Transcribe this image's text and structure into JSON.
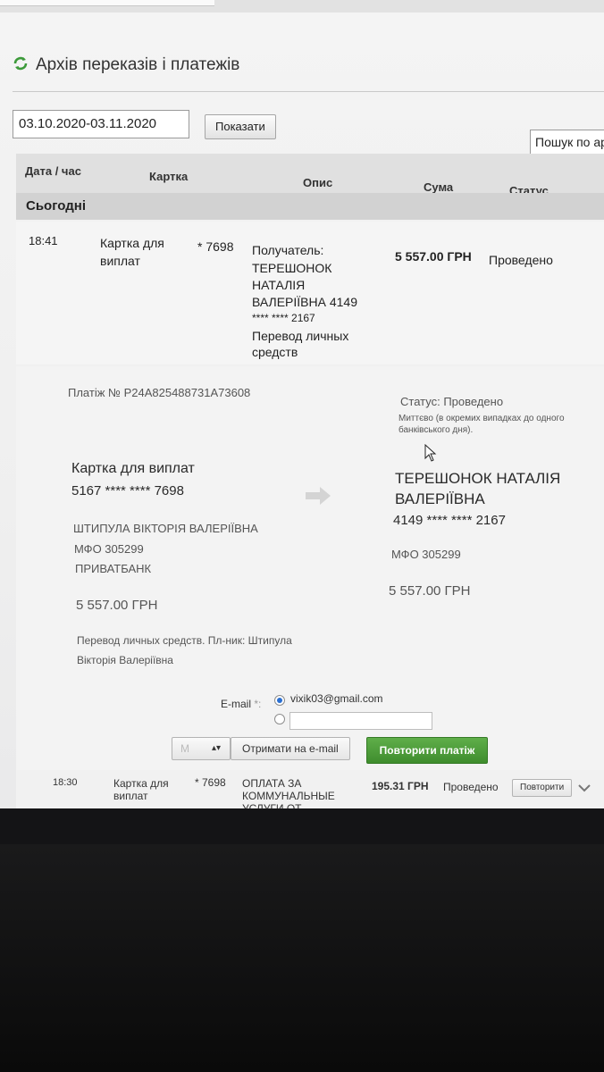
{
  "page": {
    "title": "Архів переказів і платежів"
  },
  "filters": {
    "date_range": "03.10.2020-03.11.2020",
    "show_button": "Показати",
    "search_placeholder": "Пошук по ар"
  },
  "table": {
    "headers": {
      "datetime": "Дата / час",
      "card": "Картка",
      "description": "Опис",
      "amount": "Сума",
      "status": "Статус"
    },
    "group_label": "Сьогодні"
  },
  "transaction1": {
    "time": "18:41",
    "card_line1": "Картка для",
    "card_line2": "виплат",
    "card_last4": "* 7698",
    "desc_line1": "Получатель:",
    "desc_line2": "ТЕРЕШОНОК",
    "desc_line3": "НАТАЛІЯ",
    "desc_line4": "ВАЛЕРІЇВНА 4149",
    "desc_line5": "**** **** 2167",
    "desc_line6": "Перевод личных",
    "desc_line7": "средств",
    "amount": "5 557.00 ГРН",
    "status": "Проведено"
  },
  "detail": {
    "payment_no": "Платіж № P24A825488731A73608",
    "status_line": "Статус: Проведено",
    "status_note_line1": "Миттєво (в окремих випадках до одного",
    "status_note_line2": "банківського дня).",
    "sender": {
      "card_name": "Картка для виплат",
      "card_number": "5167 **** **** 7698",
      "holder": "ШТИПУЛА ВІКТОРІЯ ВАЛЕРІЇВНА",
      "mfo": "МФО 305299",
      "bank": "ПРИВАТБАНК",
      "amount": "5 557.00 ГРН"
    },
    "receiver": {
      "name_line1": "ТЕРЕШОНОК НАТАЛІЯ",
      "name_line2": "ВАЛЕРІЇВНА",
      "card_number": "4149 **** **** 2167",
      "mfo": "МФО 305299",
      "amount": "5 557.00 ГРН"
    },
    "purpose_line1": "Перевод личных средств. Пл-ник: Штипула",
    "purpose_line2": "Вікторія Валеріївна",
    "email_label": "E-mail",
    "email_required_mark": "*:",
    "email_value": "vixik03@gmail.com",
    "format_value": "M",
    "get_email_button": "Отримати на e-mail",
    "repeat_button": "Повторити платіж"
  },
  "transaction2": {
    "time": "18:30",
    "card_line1": "Картка для",
    "card_line2": "виплат",
    "card_last4": "* 7698",
    "desc_line1": "ОПЛАТА ЗА",
    "desc_line2": "КОММУНАЛЬНЫЕ",
    "desc_line3": "УСЛУГИ ОТ",
    "amount": "195.31 ГРН",
    "status": "Проведено",
    "repeat_button": "Повторити"
  },
  "colors": {
    "accent_green": "#4a9c37",
    "refresh_icon": "#3c9a3a"
  }
}
